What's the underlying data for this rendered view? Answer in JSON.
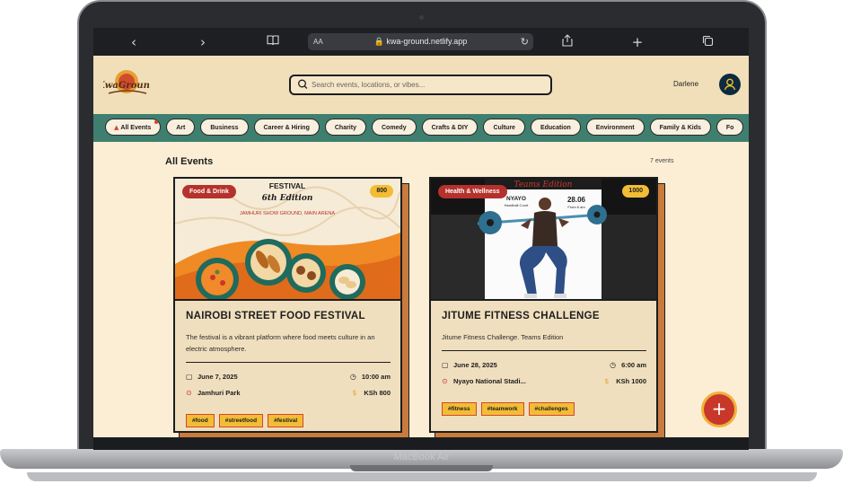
{
  "device": {
    "brand": "MacBook Air"
  },
  "browser": {
    "address_prefix": "AA",
    "url": "🔒 kwa-ground.netlify.app",
    "reload_icon": "reload-icon",
    "icons": {
      "back": "‹",
      "forward": "›",
      "bookmarks": "📖",
      "share": "⇪",
      "new_tab": "+",
      "tabs": "⧉"
    }
  },
  "header": {
    "logo_text": "KwaGround",
    "search": {
      "placeholder": "Search events, locations, or vibes..."
    },
    "user": {
      "name": "Darlene"
    }
  },
  "categories": {
    "items": [
      "All Events",
      "Art",
      "Business",
      "Career & Hiring",
      "Charity",
      "Comedy",
      "Crafts & DIY",
      "Culture",
      "Education",
      "Environment",
      "Family & Kids",
      "Fo"
    ],
    "active": "All Events"
  },
  "main": {
    "title": "All Events",
    "count": "7 events",
    "cards": [
      {
        "category": "Food & Drink",
        "price_badge": "800",
        "image_text": {
          "line1": "FESTIVAL",
          "line2": "6th Edition",
          "location": "JAMHURI SHOW GROUND, MAIN ARENA"
        },
        "title": "NAIROBI STREET FOOD FESTIVAL",
        "description": "The festival is a vibrant platform where food meets culture in an electric atmosphere.",
        "date": "June 7, 2025",
        "time": "10:00 am",
        "venue": "Jamhuri Park",
        "price": "KSh 800",
        "tags": [
          "#food",
          "#streetfood",
          "#festival"
        ]
      },
      {
        "category": "Health & Wellness",
        "price_badge": "1000",
        "image_text": {
          "venue": "NYAYO",
          "venue_sub": "Handball Court",
          "date": "28.06",
          "date_sub": "From 6 am",
          "banner": "Teams Edition"
        },
        "title": "JITUME FITNESS CHALLENGE",
        "description": "Jitume Fitness Challenge. Teams Edition",
        "date": "June 28, 2025",
        "time": "6:00 am",
        "venue": "Nyayo National Stadi...",
        "price": "KSh 1000",
        "tags": [
          "#fitness",
          "#teamwork",
          "#challenges"
        ]
      }
    ]
  },
  "fab": {
    "label": "+"
  },
  "colors": {
    "header_bg": "#f1dfba",
    "catbar_bg": "#3f7f70",
    "accent": "#c8382a",
    "tag_bg": "#f2bd35",
    "card_bg": "#f0dfbe"
  }
}
